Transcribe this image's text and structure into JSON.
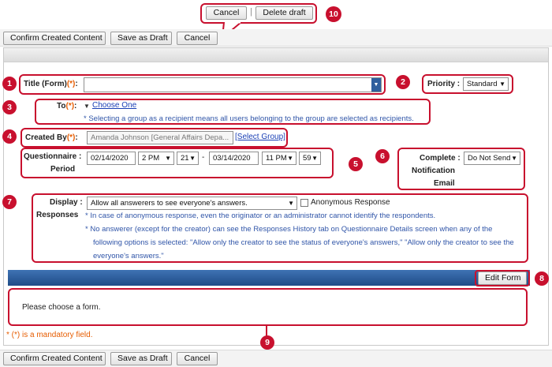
{
  "top_popup": {
    "cancel_label": "Cancel",
    "separator": "|",
    "delete_draft_label": "Delete draft",
    "marker": "10"
  },
  "toolbar_top": {
    "confirm_label": "Confirm Created Content",
    "save_draft_label": "Save as Draft",
    "cancel_label": "Cancel"
  },
  "title_field": {
    "label": "Title (Form)",
    "required": "(*)",
    "colon": ":",
    "value": "",
    "marker": "1"
  },
  "priority": {
    "label": "Priority :",
    "value": "Standard",
    "marker": "2"
  },
  "to_field": {
    "label": "To",
    "required": "(*)",
    "colon": ":",
    "choose_label": "Choose One",
    "note": "* Selecting a group as a recipient means all users belonging to the group are selected as recipients.",
    "marker": "3"
  },
  "created_by": {
    "label": "Created By",
    "required": "(*)",
    "colon": ":",
    "value": "Amanda Johnson [General Affairs Depa...",
    "select_group_label": "[Select Group]",
    "marker": "4"
  },
  "period": {
    "label_line1": "Questionnaire :",
    "label_line2": "Period",
    "start_date": "02/14/2020",
    "start_hour": "2 PM",
    "start_minute": "21",
    "dash": "-",
    "end_date": "03/14/2020",
    "end_hour": "11 PM",
    "end_minute": "59",
    "marker": "5"
  },
  "notification": {
    "label_line1": "Complete :",
    "label_line2": "Notification",
    "label_line3": "Email",
    "value": "Do Not Send",
    "marker": "6"
  },
  "display_responses": {
    "label_line1": "Display :",
    "label_line2": "Responses",
    "value": "Allow all answerers to see everyone's answers.",
    "anonymous_label": "Anonymous Response",
    "note1": "* In case of anonymous response, even the originator or an administrator cannot identify the respondents.",
    "note2_line1": "* No answerer (except for the creator) can see the Responses History tab on Questionnaire Details screen when any of the",
    "note2_line2": "following options is selected: \"Allow only the creator to see the status of everyone's answers,\" \"Allow only the creator to see the",
    "note2_line3": "everyone's answers.\"",
    "marker": "7"
  },
  "form_section": {
    "edit_form_label": "Edit Form",
    "marker": "8",
    "message": "Please choose a form.",
    "marker_area": "9"
  },
  "mandatory_note": "* (*) is a mandatory field.",
  "toolbar_bottom": {
    "confirm_label": "Confirm Created Content",
    "save_draft_label": "Save as Draft",
    "cancel_label": "Cancel"
  },
  "colors": {
    "annotation_red": "#c8102e",
    "required_orange": "#e65c00",
    "note_blue": "#3055a8",
    "header_blue": "#2b5e9c"
  }
}
